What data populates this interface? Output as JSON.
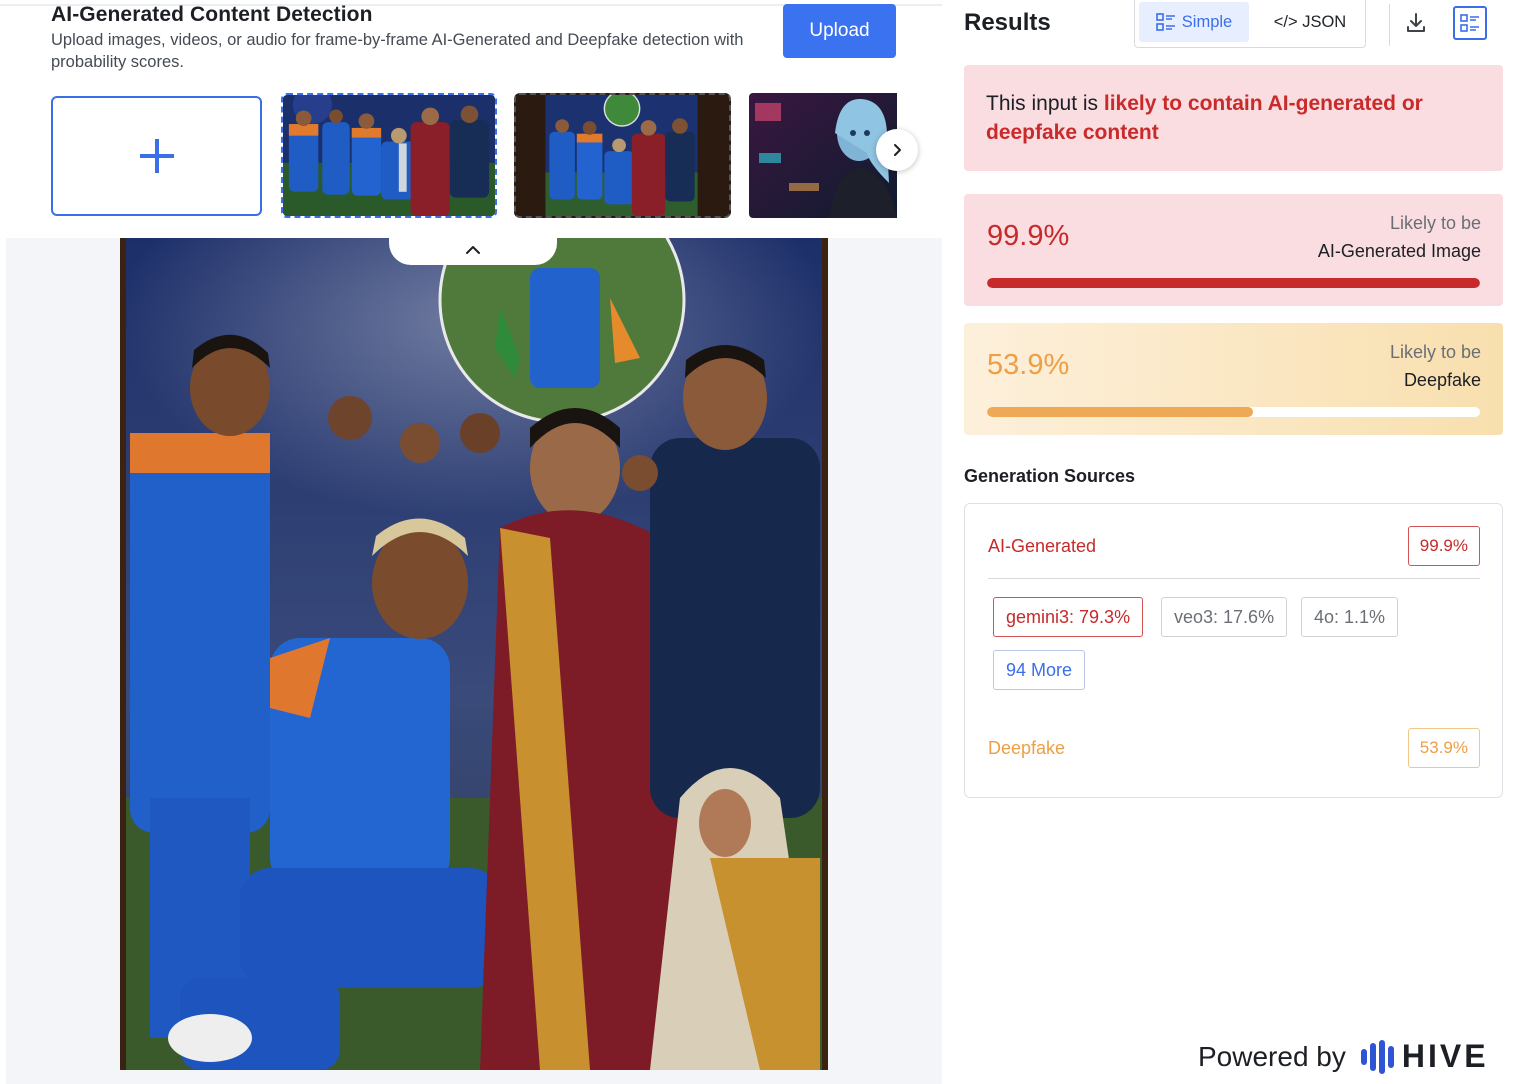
{
  "header": {
    "title": "AI-Generated Content Detection",
    "subtitle": "Upload images, videos, or audio for frame-by-frame AI-Generated and Deepfake detection with probability scores.",
    "upload_label": "Upload"
  },
  "results": {
    "title": "Results",
    "view_simple": "Simple",
    "view_json": "</> JSON",
    "verdict_prefix": "This input is ",
    "verdict_highlight": "likely to contain AI-generated or deepfake content",
    "ai_score": {
      "value_text": "99.9%",
      "value": 0.999,
      "line1": "Likely to be",
      "line2": "AI-Generated Image"
    },
    "deepfake_score": {
      "value_text": "53.9%",
      "value": 0.539,
      "line1": "Likely to be",
      "line2": "Deepfake"
    }
  },
  "generation_sources": {
    "title": "Generation Sources",
    "ai_label": "AI-Generated",
    "ai_value": "99.9%",
    "chips": {
      "gemini": "gemini3: 79.3%",
      "veo": "veo3: 17.6%",
      "o4": "4o: 1.1%",
      "more": "94 More"
    },
    "deepfake_label": "Deepfake",
    "deepfake_value": "53.9%"
  },
  "footer": {
    "powered_by": "Powered by",
    "brand": "HIVE"
  },
  "colors": {
    "accent_blue": "#3b72f0",
    "ai_red": "#c62a2a",
    "deepfake_orange": "#ee9f45"
  }
}
